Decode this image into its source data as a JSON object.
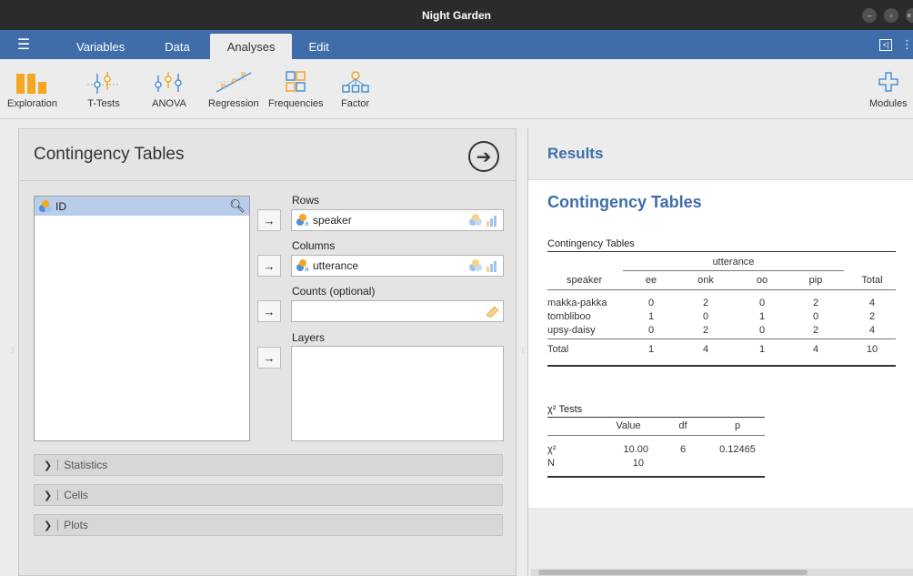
{
  "window": {
    "title": "Night Garden"
  },
  "menu": {
    "tabs": [
      {
        "label": "Variables"
      },
      {
        "label": "Data"
      },
      {
        "label": "Analyses"
      },
      {
        "label": "Edit"
      }
    ]
  },
  "ribbon": {
    "buttons": [
      {
        "label": "Exploration"
      },
      {
        "label": "T-Tests"
      },
      {
        "label": "ANOVA"
      },
      {
        "label": "Regression"
      },
      {
        "label": "Frequencies"
      },
      {
        "label": "Factor"
      }
    ],
    "modules_label": "Modules"
  },
  "colors": {
    "accent": "#3e6da9",
    "ribbon_orange": "#f5a623",
    "ribbon_blue": "#4a90d9"
  },
  "analysis": {
    "title": "Contingency Tables",
    "variables": [
      "ID"
    ],
    "rows_label": "Rows",
    "rows_value": "speaker",
    "columns_label": "Columns",
    "columns_value": "utterance",
    "counts_label": "Counts (optional)",
    "layers_label": "Layers",
    "sections": [
      "Statistics",
      "Cells",
      "Plots"
    ]
  },
  "results": {
    "header": "Results",
    "title": "Contingency Tables",
    "table1": {
      "caption": "Contingency Tables",
      "group_header": "utterance",
      "row_header": "speaker",
      "columns": [
        "ee",
        "onk",
        "oo",
        "pip",
        "Total"
      ],
      "rows": [
        {
          "label": "makka-pakka",
          "values": [
            "0",
            "2",
            "0",
            "2",
            "4"
          ]
        },
        {
          "label": "tombliboo",
          "values": [
            "1",
            "0",
            "1",
            "0",
            "2"
          ]
        },
        {
          "label": "upsy-daisy",
          "values": [
            "0",
            "2",
            "0",
            "2",
            "4"
          ]
        }
      ],
      "total": {
        "label": "Total",
        "values": [
          "1",
          "4",
          "1",
          "4",
          "10"
        ]
      }
    },
    "table2": {
      "caption": "χ² Tests",
      "columns": [
        "Value",
        "df",
        "p"
      ],
      "rows": [
        {
          "label": "χ²",
          "values": [
            "10.00",
            "6",
            "0.12465"
          ]
        },
        {
          "label": "N",
          "values": [
            "10",
            "",
            ""
          ]
        }
      ]
    }
  }
}
